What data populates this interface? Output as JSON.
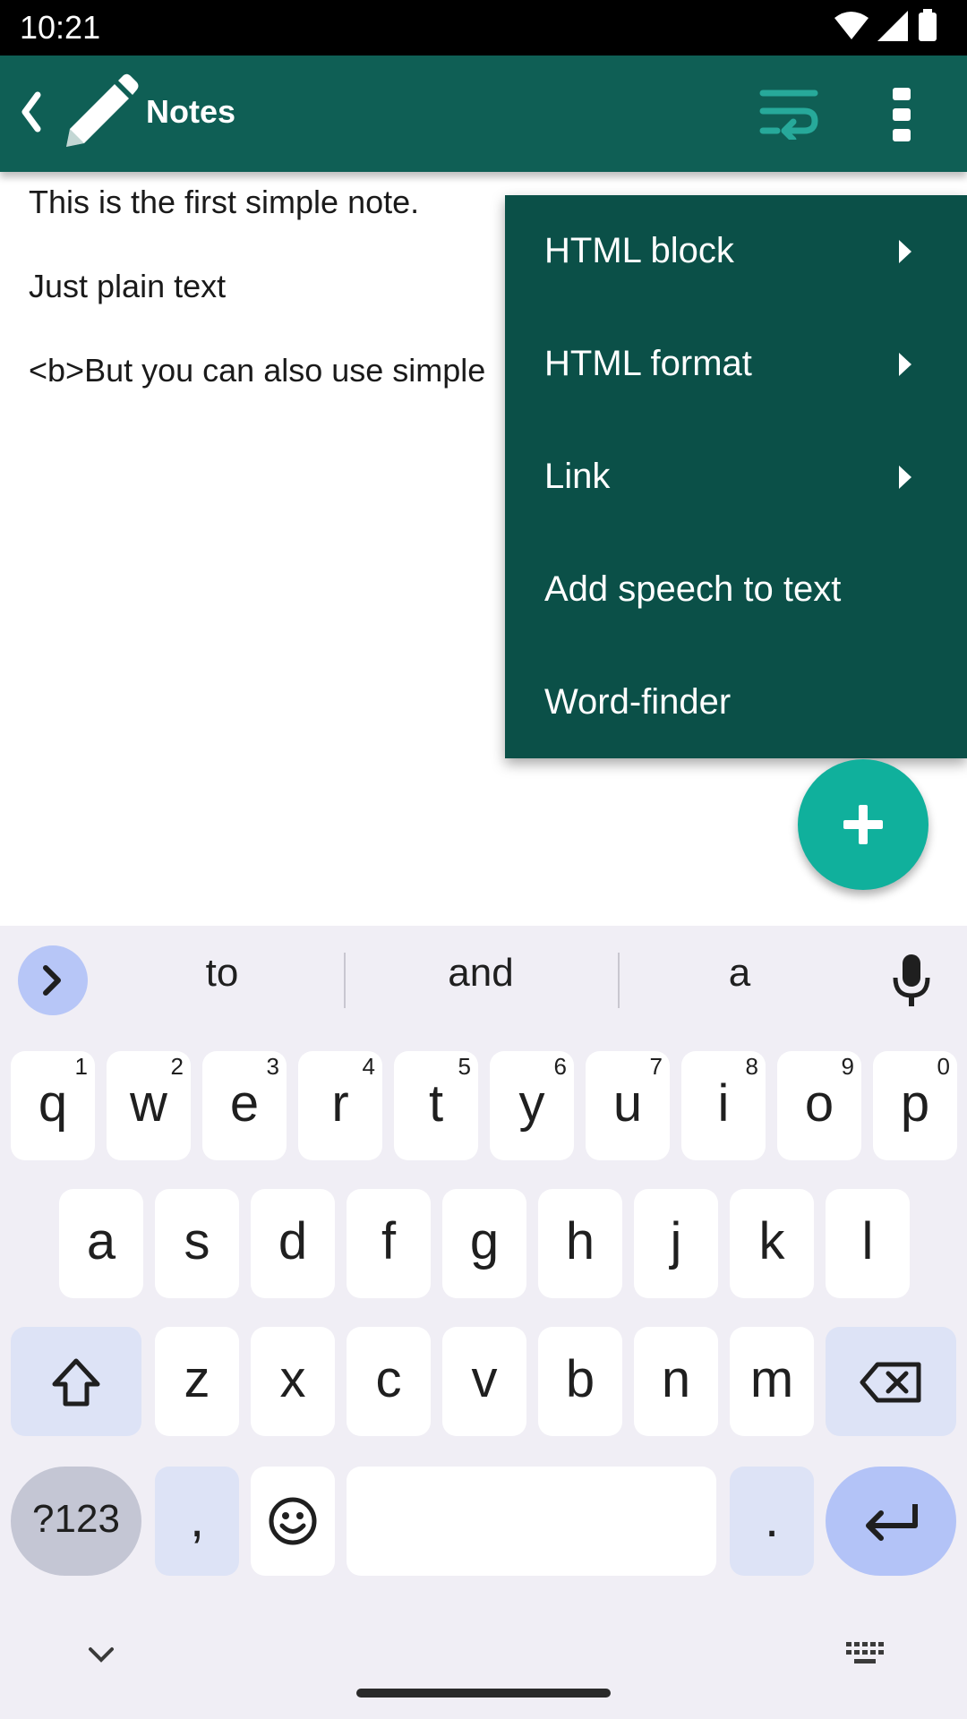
{
  "status_bar": {
    "time": "10:21"
  },
  "app_bar": {
    "title": "Notes"
  },
  "note": {
    "lines": [
      "This is the first simple note.",
      "Just plain text",
      "<b>But you can also use simple"
    ]
  },
  "menu": {
    "items": [
      {
        "label": "HTML block",
        "submenu": true
      },
      {
        "label": "HTML format",
        "submenu": true
      },
      {
        "label": "Link",
        "submenu": true
      },
      {
        "label": "Add speech to text",
        "submenu": false
      },
      {
        "label": "Word-finder",
        "submenu": false
      }
    ]
  },
  "fab": {
    "icon": "plus-icon"
  },
  "keyboard": {
    "suggestions": [
      "to",
      "and",
      "a"
    ],
    "row1": [
      {
        "key": "q",
        "hint": "1"
      },
      {
        "key": "w",
        "hint": "2"
      },
      {
        "key": "e",
        "hint": "3"
      },
      {
        "key": "r",
        "hint": "4"
      },
      {
        "key": "t",
        "hint": "5"
      },
      {
        "key": "y",
        "hint": "6"
      },
      {
        "key": "u",
        "hint": "7"
      },
      {
        "key": "i",
        "hint": "8"
      },
      {
        "key": "o",
        "hint": "9"
      },
      {
        "key": "p",
        "hint": "0"
      }
    ],
    "row2": [
      "a",
      "s",
      "d",
      "f",
      "g",
      "h",
      "j",
      "k",
      "l"
    ],
    "row3": [
      "z",
      "x",
      "c",
      "v",
      "b",
      "n",
      "m"
    ],
    "symbols_label": "?123",
    "comma": ",",
    "period": "."
  },
  "colors": {
    "app_bar": "#0f5f55",
    "menu": "#0b5048",
    "fab": "#10b09c",
    "wrap_icon": "#27a99a"
  }
}
